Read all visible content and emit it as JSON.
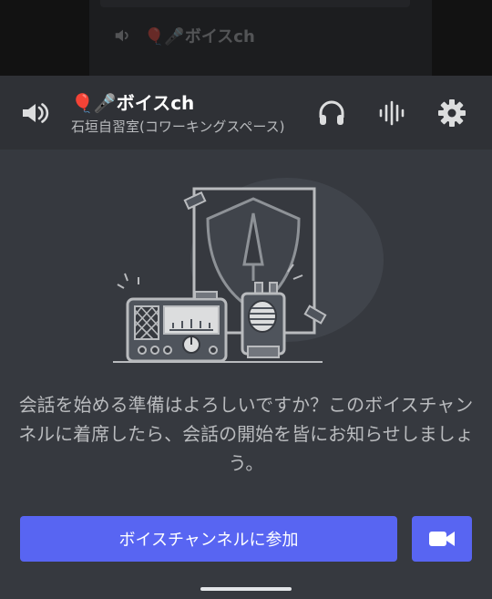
{
  "background": {
    "channel_name": "🎈🎤ボイスch"
  },
  "header": {
    "title": "🎈🎤ボイスch",
    "subtitle": "石垣自習室(コワーキングスペース)",
    "icons": [
      "speaker-icon",
      "headphones-icon",
      "voice-waveform-icon",
      "gear-icon"
    ]
  },
  "main": {
    "description": "会話を始める準備はよろしいですか？このボイスチャンネルに着席したら、会話の開始を皆にお知らせしましょう。"
  },
  "actions": {
    "join_label": "ボイスチャンネルに参加",
    "video_icon": "video-camera-icon"
  },
  "colors": {
    "accent": "#5865f2",
    "background": "#36393f",
    "header": "#2f3136"
  }
}
